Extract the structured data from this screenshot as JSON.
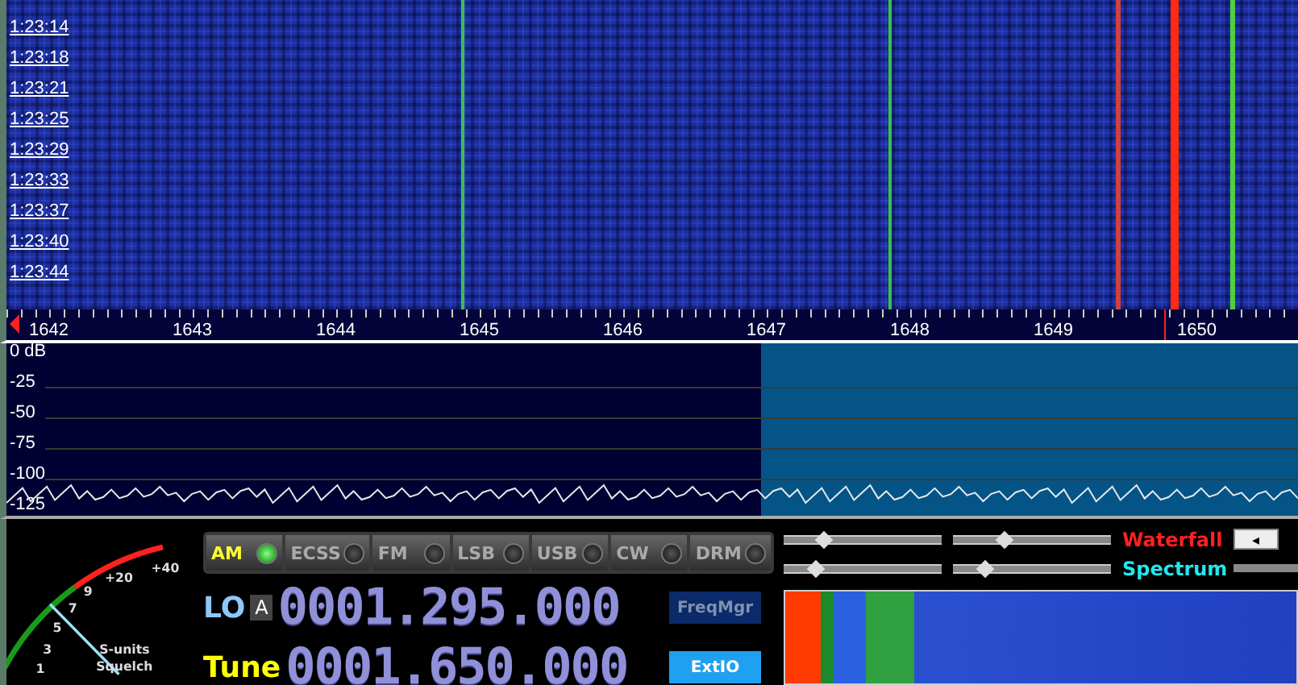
{
  "waterfall": {
    "times": [
      "1:23:14",
      "1:23:18",
      "1:23:21",
      "1:23:25",
      "1:23:29",
      "1:23:33",
      "1:23:37",
      "1:23:40",
      "1:23:44"
    ]
  },
  "frequency_axis": {
    "labels": [
      "1642",
      "1643",
      "1644",
      "1645",
      "1646",
      "1647",
      "1648",
      "1649",
      "1650"
    ]
  },
  "spectrum": {
    "db_labels": [
      "0 dB",
      "-25",
      "-50",
      "-75",
      "-100",
      "-125"
    ]
  },
  "s_meter": {
    "scale": [
      "1",
      "3",
      "5",
      "7",
      "9",
      "+20",
      "+40"
    ],
    "caption_1": "S-units",
    "caption_2": "Squelch"
  },
  "modes": [
    {
      "label": "AM",
      "selected": true
    },
    {
      "label": "ECSS",
      "selected": false
    },
    {
      "label": "FM",
      "selected": false
    },
    {
      "label": "LSB",
      "selected": false
    },
    {
      "label": "USB",
      "selected": false
    },
    {
      "label": "CW",
      "selected": false
    },
    {
      "label": "DRM",
      "selected": false
    }
  ],
  "lo": {
    "label": "LO",
    "badge": "A",
    "frequency": "0001.295.000",
    "button": "FreqMgr"
  },
  "tune": {
    "label": "Tune",
    "frequency": "0001.650.000",
    "button": "ExtIO"
  },
  "display_controls": [
    {
      "label": "Waterfall",
      "color": "#ff2020",
      "sliders": [
        {
          "level": 0.2
        },
        {
          "level": 0.28
        }
      ],
      "button": "◂"
    },
    {
      "label": "Spectrum",
      "color": "#20e8f0",
      "sliders": [
        {
          "level": 0.15
        },
        {
          "level": 0.15
        }
      ]
    }
  ]
}
